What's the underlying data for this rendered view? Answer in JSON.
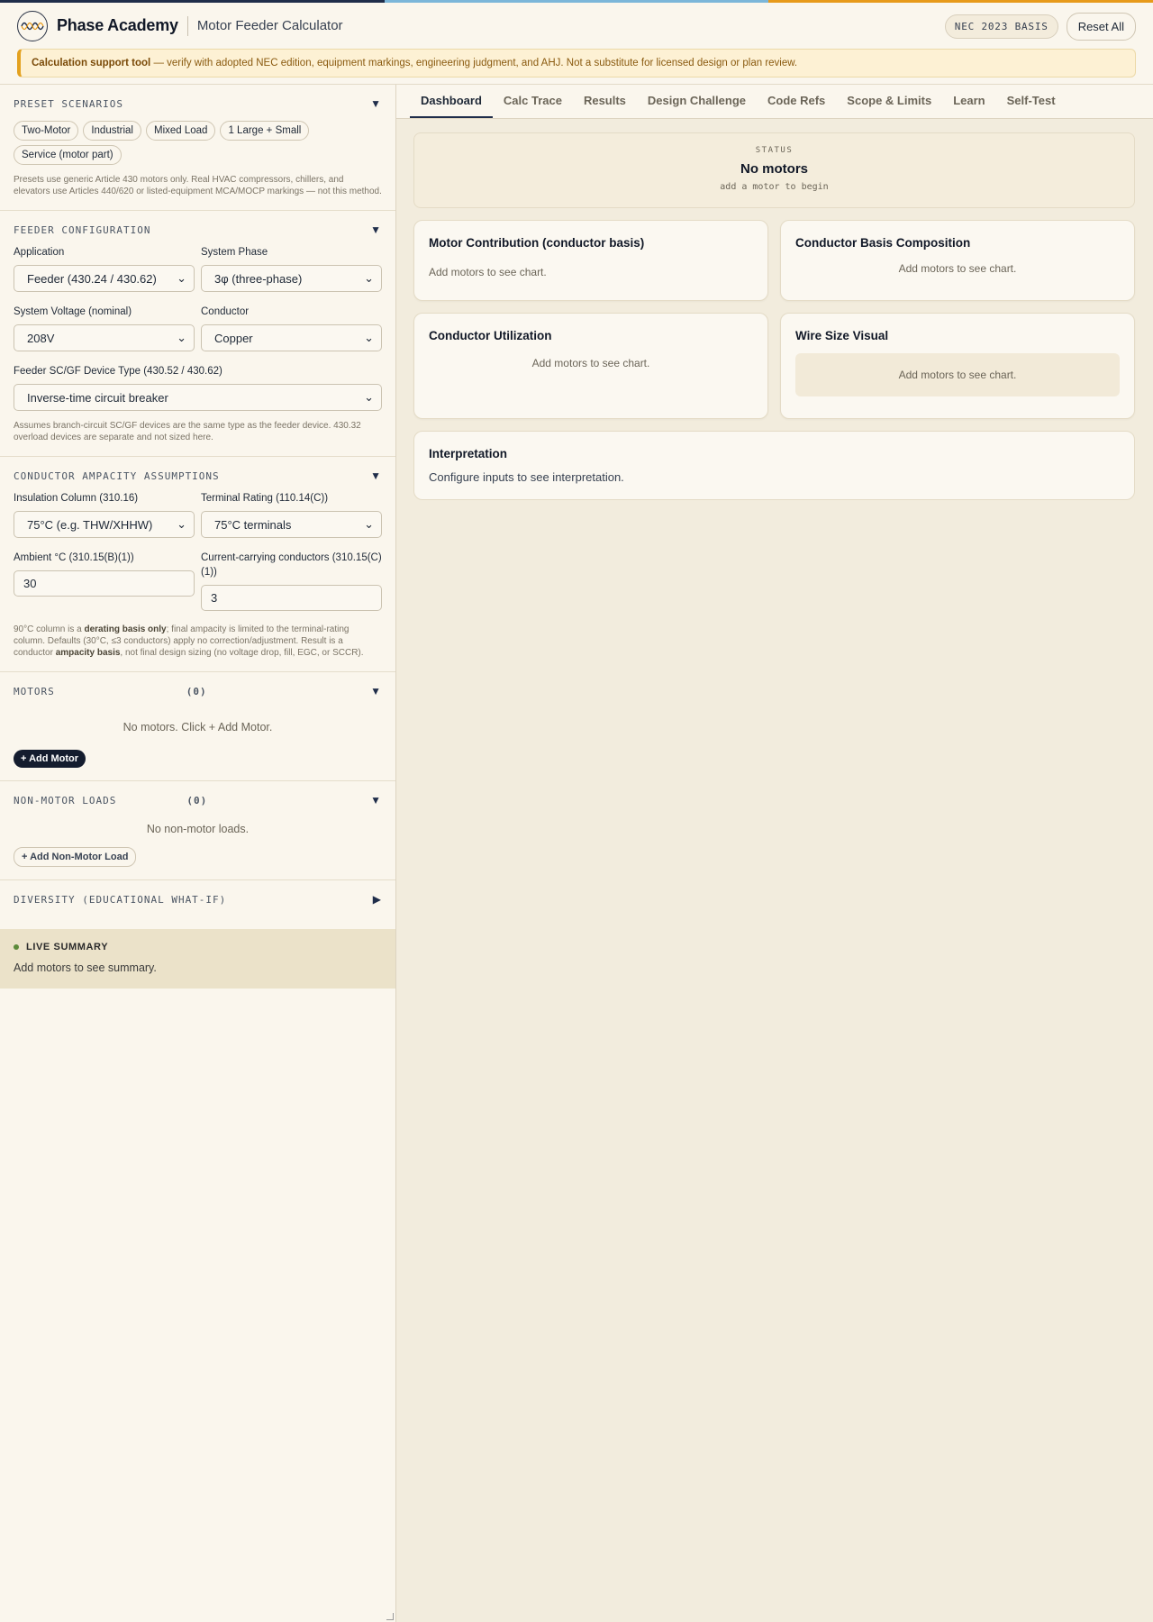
{
  "header": {
    "brand": "Phase Academy",
    "app_title": "Motor Feeder Calculator",
    "basis_badge": "NEC 2023 BASIS",
    "reset_label": "Reset All",
    "stripe_colors": [
      "#1f2d4a",
      "#7bb6d9",
      "#e79a1a"
    ]
  },
  "banner": {
    "bold": "Calculation support tool",
    "text": " — verify with adopted NEC edition, equipment markings, engineering judgment, and AHJ. Not a substitute for licensed design or plan review."
  },
  "sidebar": {
    "presets": {
      "title": "PRESET SCENARIOS",
      "items": [
        "Two-Motor",
        "Industrial",
        "Mixed Load",
        "1 Large + Small",
        "Service (motor part)"
      ],
      "note": "Presets use generic Article 430 motors only. Real HVAC compressors, chillers, and elevators use Articles 440/620 or listed-equipment MCA/MOCP markings — not this method."
    },
    "feeder": {
      "title": "FEEDER CONFIGURATION",
      "application_label": "Application",
      "application_value": "Feeder (430.24 / 430.62)",
      "phase_label": "System Phase",
      "phase_value": "3φ (three-phase)",
      "voltage_label": "System Voltage (nominal)",
      "voltage_value": "208V",
      "conductor_label": "Conductor",
      "conductor_value": "Copper",
      "device_label": "Feeder SC/GF Device Type (430.52 / 430.62)",
      "device_value": "Inverse-time circuit breaker",
      "note": "Assumes branch-circuit SC/GF devices are the same type as the feeder device. 430.32 overload devices are separate and not sized here."
    },
    "ampacity": {
      "title": "CONDUCTOR AMPACITY ASSUMPTIONS",
      "insulation_label": "Insulation Column (310.16)",
      "insulation_value": "75°C (e.g. THW/XHHW)",
      "terminal_label": "Terminal Rating (110.14(C))",
      "terminal_value": "75°C terminals",
      "ambient_label": "Ambient °C (310.15(B)(1))",
      "ambient_value": "30",
      "ccc_label": "Current-carrying conductors (310.15(C)(1))",
      "ccc_value": "3",
      "note_1": "90°C column is a ",
      "note_b1": "derating basis only",
      "note_2": "; final ampacity is limited to the terminal-rating column. Defaults (30°C, ≤3 conductors) apply no correction/adjustment. Result is a conductor ",
      "note_b2": "ampacity basis",
      "note_3": ", not final design sizing (no voltage drop, fill, EGC, or SCCR)."
    },
    "motors": {
      "title": "MOTORS",
      "count": "(0)",
      "empty": "No motors. Click + Add Motor.",
      "add_label": "+ Add Motor"
    },
    "nonmotor": {
      "title": "NON-MOTOR LOADS",
      "count": "(0)",
      "empty": "No non-motor loads.",
      "add_label": "+ Add Non-Motor Load"
    },
    "diversity": {
      "title": "DIVERSITY (EDUCATIONAL WHAT-IF)"
    },
    "live": {
      "title": "LIVE SUMMARY",
      "text": "Add motors to see summary."
    }
  },
  "tabs": [
    "Dashboard",
    "Calc Trace",
    "Results",
    "Design Challenge",
    "Code Refs",
    "Scope & Limits",
    "Learn",
    "Self-Test"
  ],
  "status": {
    "label": "STATUS",
    "value": "No motors",
    "sub": "add a motor to begin"
  },
  "cards": {
    "contribution": {
      "title": "Motor Contribution (conductor basis)",
      "empty": "Add motors to see chart."
    },
    "composition": {
      "title": "Conductor Basis Composition",
      "empty": "Add motors to see chart."
    },
    "utilization": {
      "title": "Conductor Utilization",
      "empty": "Add motors to see chart."
    },
    "wire": {
      "title": "Wire Size Visual",
      "empty": "Add motors to see chart."
    }
  },
  "interpretation": {
    "title": "Interpretation",
    "text": "Configure inputs to see interpretation."
  }
}
